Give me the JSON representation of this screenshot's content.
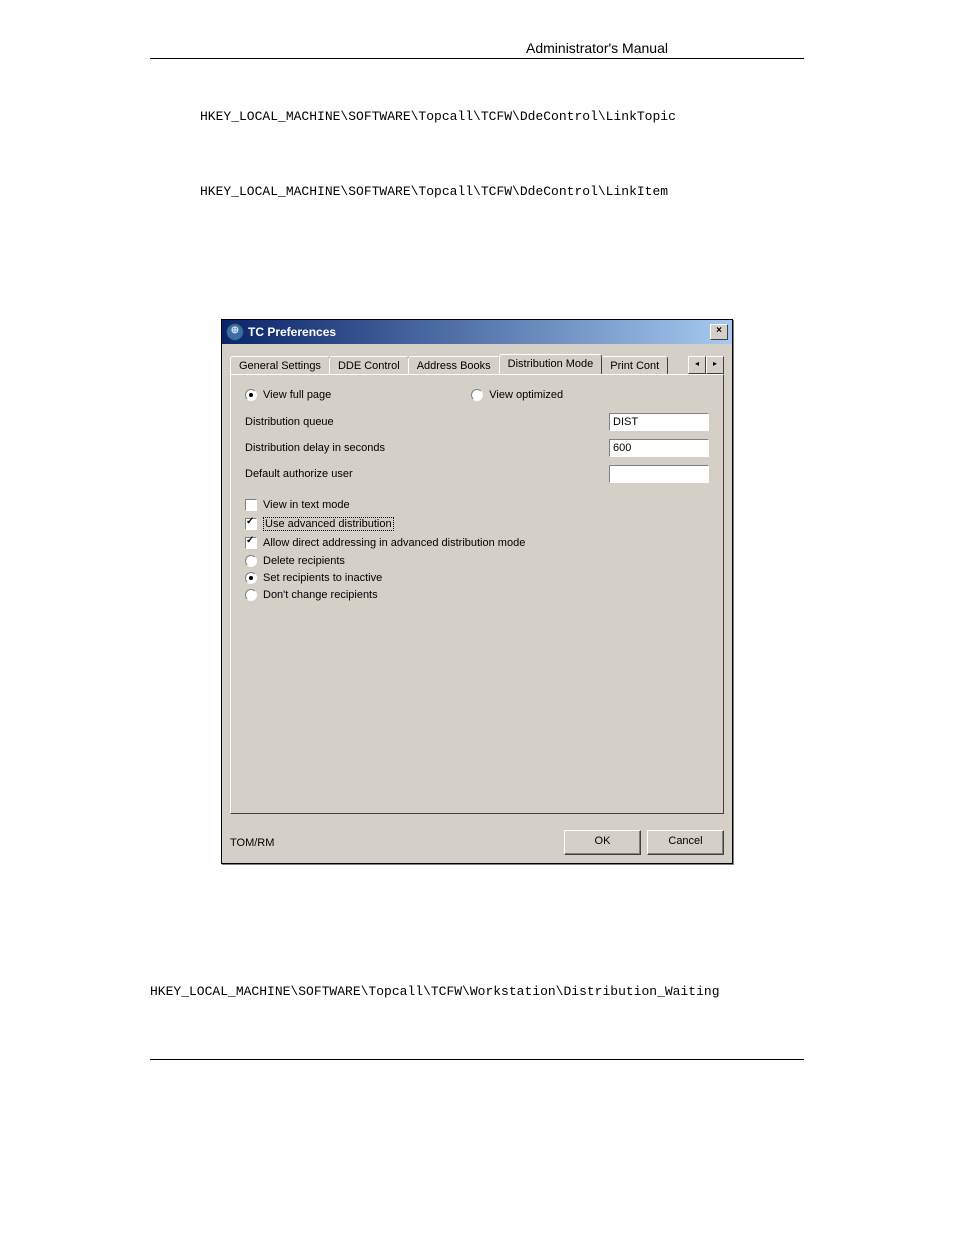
{
  "header": {
    "title": "Administrator's Manual"
  },
  "reg_keys": {
    "link_topic": "HKEY_LOCAL_MACHINE\\SOFTWARE\\Topcall\\TCFW\\DdeControl\\LinkTopic",
    "link_item": "HKEY_LOCAL_MACHINE\\SOFTWARE\\Topcall\\TCFW\\DdeControl\\LinkItem",
    "dist_waiting": "HKEY_LOCAL_MACHINE\\SOFTWARE\\Topcall\\TCFW\\Workstation\\Distribution_Waiting"
  },
  "dialog": {
    "title": "TC Preferences",
    "close": "×",
    "tabs": {
      "general": "General Settings",
      "dde": "DDE Control",
      "address": "Address Books",
      "dist": "Distribution Mode",
      "print": "Print Cont"
    },
    "view_full": "View full page",
    "view_opt": "View optimized",
    "dist_queue_label": "Distribution queue",
    "dist_queue_value": "DIST",
    "dist_delay_label": "Distribution delay in seconds",
    "dist_delay_value": "600",
    "auth_user_label": "Default authorize user",
    "auth_user_value": "",
    "view_text": "View in text mode",
    "use_adv": "Use advanced distribution",
    "allow_direct": "Allow direct addressing in advanced distribution mode",
    "delete_recip": "Delete recipients",
    "set_inactive": "Set recipients to inactive",
    "dont_change": "Don't change recipients",
    "status": "TOM/RM",
    "ok": "OK",
    "cancel": "Cancel"
  }
}
